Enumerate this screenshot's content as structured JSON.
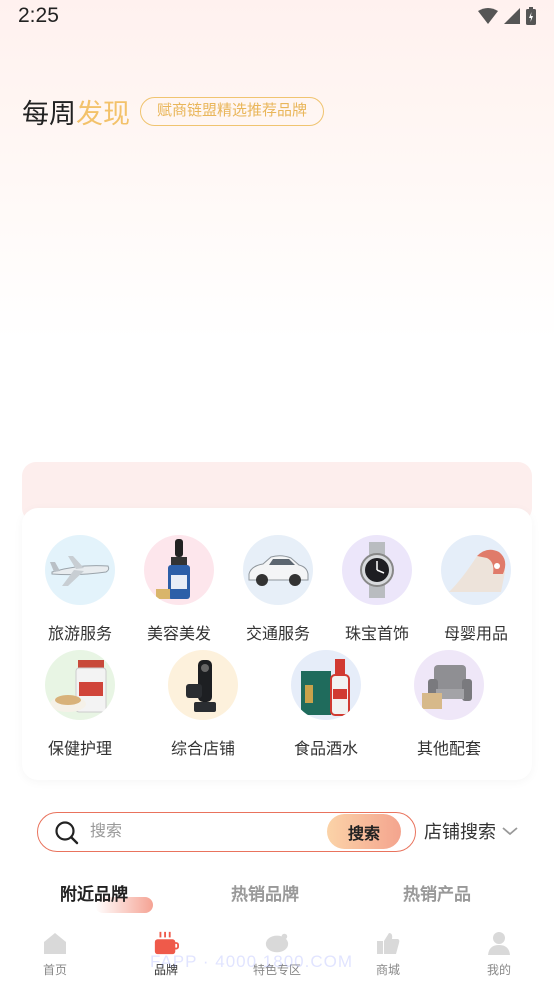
{
  "status_bar": {
    "time": "2:25"
  },
  "headline": {
    "main": "每周",
    "accent": "发现",
    "tag": "赋商链盟精选推荐品牌"
  },
  "categories_row1": [
    {
      "label": "旅游服务",
      "icon": "airplane-icon"
    },
    {
      "label": "美容美发",
      "icon": "serum-bottle-icon"
    },
    {
      "label": "交通服务",
      "icon": "car-icon"
    },
    {
      "label": "珠宝首饰",
      "icon": "watch-icon"
    },
    {
      "label": "母婴用品",
      "icon": "baby-slide-icon"
    }
  ],
  "categories_row2": [
    {
      "label": "保健护理",
      "icon": "supplement-icon"
    },
    {
      "label": "综合店铺",
      "icon": "gimbal-icon"
    },
    {
      "label": "食品酒水",
      "icon": "liquor-icon"
    },
    {
      "label": "其他配套",
      "icon": "armchair-icon"
    }
  ],
  "search": {
    "placeholder": "搜索",
    "button": "搜索",
    "store_search": "店铺搜索"
  },
  "tabs": [
    "附近品牌",
    "热销品牌",
    "热销产品"
  ],
  "bottom_nav": [
    {
      "label": "首页",
      "icon": "home-icon"
    },
    {
      "label": "品牌",
      "icon": "brand-icon"
    },
    {
      "label": "特色专区",
      "icon": "piggy-icon"
    },
    {
      "label": "商城",
      "icon": "thumbs-up-icon"
    },
    {
      "label": "我的",
      "icon": "profile-icon"
    }
  ],
  "watermark": "FAPP · 4000 1800.COM",
  "colors": {
    "accent": "#f3c26a",
    "search_border": "#e9735d",
    "button_gradient_start": "#fbd3a8",
    "button_gradient_end": "#f4a48e"
  }
}
